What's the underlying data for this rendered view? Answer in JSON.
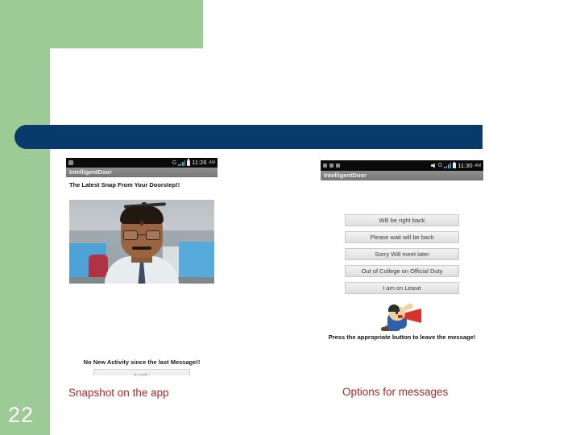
{
  "slide": {
    "number": "22",
    "accent_green": "#9ccb96",
    "accent_navy": "#083a6b",
    "caption_color": "#9e2a2b"
  },
  "left_screenshot": {
    "status_bar": {
      "time": "11:26",
      "ampm": "AM",
      "carrier_label": "G",
      "icons": [
        "notification-icon",
        "signal-icon",
        "battery-icon"
      ]
    },
    "app_title": "IntelligentDoor",
    "heading": "The Latest Snap From Your Doorstep!!",
    "photo_alt": "Webcam snapshot of a man wearing glasses in an office",
    "status_message": "No New Activity since the last Message!!",
    "notify_button": "Notify",
    "caption": "Snapshot on the app"
  },
  "right_screenshot": {
    "status_bar": {
      "time": "11:30",
      "ampm": "AM",
      "carrier_label": "G",
      "icons": [
        "notification-icon",
        "notification-icon",
        "notification-icon",
        "mute-icon",
        "signal-icon",
        "battery-icon"
      ]
    },
    "app_title": "IntelligentDoor",
    "message_options": [
      "Will be right back",
      "Please wait will be back",
      "Sorry Will meet later",
      "Out of College on Official Duty",
      "I am on Leave"
    ],
    "art_alt": "Cartoon man shouting into a red megaphone",
    "instruction": "Press the appropriate button to leave the message!",
    "caption": "Options for messages"
  }
}
